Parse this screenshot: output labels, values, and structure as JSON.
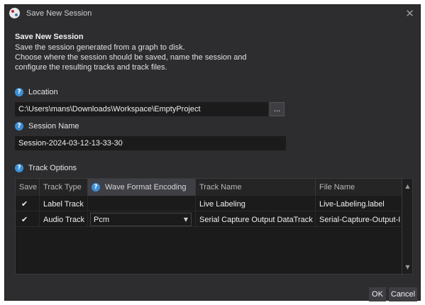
{
  "window": {
    "title": "Save New Session",
    "close_glyph": "✕",
    "icon": "app-logo-icon"
  },
  "header": {
    "title": "Save New Session",
    "lines": [
      "Save the session generated from a graph to disk.",
      "Choose where the session should be saved, name the session and",
      "configure the resulting tracks and track files."
    ]
  },
  "location": {
    "label": "Location",
    "value": "C:\\Users\\mans\\Downloads\\Workspace\\EmptyProject",
    "browse_label": "..."
  },
  "session_name": {
    "label": "Session Name",
    "value": "Session-2024-03-12-13-33-30"
  },
  "track_options": {
    "label": "Track Options",
    "columns": [
      "Save",
      "Track Type",
      "Wave Format Encoding",
      "Track Name",
      "File Name"
    ],
    "rows": [
      {
        "save": "✔",
        "track_type": "Label Track",
        "wave_format": "",
        "track_name": "Live Labeling",
        "file_name": "Live-Labeling.label"
      },
      {
        "save": "✔",
        "track_type": "Audio Track",
        "wave_format": "Pcm",
        "track_name": "Serial Capture Output DataTrack",
        "file_name": "Serial-Capture-Output-I"
      }
    ]
  },
  "footer": {
    "ok_label": "OK",
    "cancel_label": "Cancel"
  },
  "colors": {
    "background": "#2d2d30",
    "field": "#1b1b1c",
    "accent": "#3d8fd6"
  }
}
